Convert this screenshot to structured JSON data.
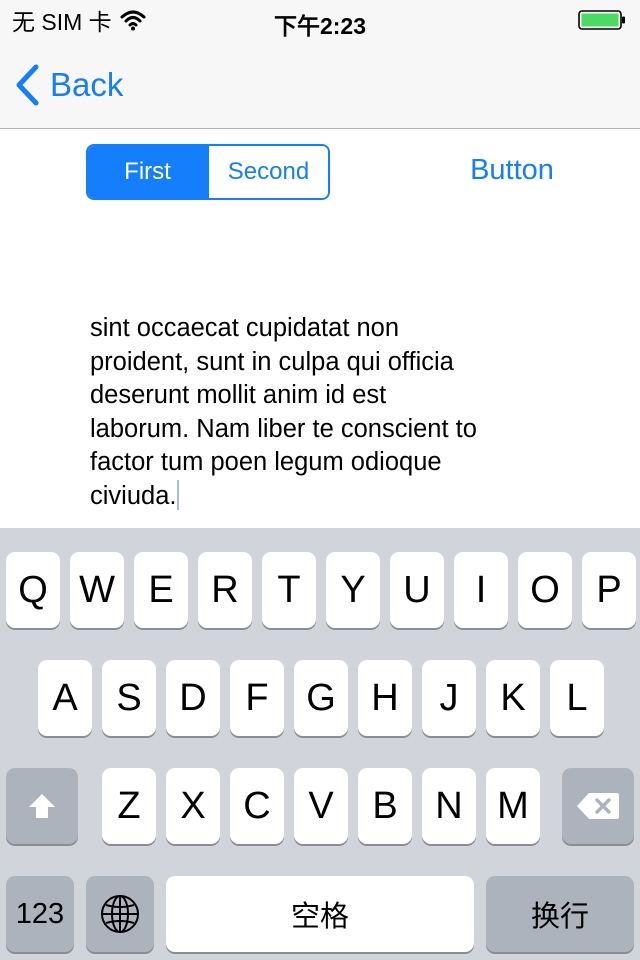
{
  "status_bar": {
    "carrier": "无 SIM 卡",
    "time": "下午2:23",
    "battery_color": "#4cd964"
  },
  "nav": {
    "back_label": "Back",
    "accent_color": "#147efb"
  },
  "segmented_control": {
    "segments": [
      "First",
      "Second"
    ],
    "selected": "First"
  },
  "button_label": "Button",
  "text_view": {
    "lines": [
      "sint occaecat cupidatat non",
      "proident, sunt in culpa qui officia",
      "deserunt mollit anim id est",
      "laborum. Nam liber te conscient to",
      "factor tum poen legum odioque",
      "civiuda."
    ]
  },
  "keyboard": {
    "row1": [
      "Q",
      "W",
      "E",
      "R",
      "T",
      "Y",
      "U",
      "I",
      "O",
      "P"
    ],
    "row2": [
      "A",
      "S",
      "D",
      "F",
      "G",
      "H",
      "J",
      "K",
      "L"
    ],
    "row3": [
      "Z",
      "X",
      "C",
      "V",
      "B",
      "N",
      "M"
    ],
    "numbers_label": "123",
    "space_label": "空格",
    "return_label": "换行",
    "shift_icon": "shift-icon",
    "delete_icon": "delete-icon",
    "globe_icon": "globe-icon"
  }
}
